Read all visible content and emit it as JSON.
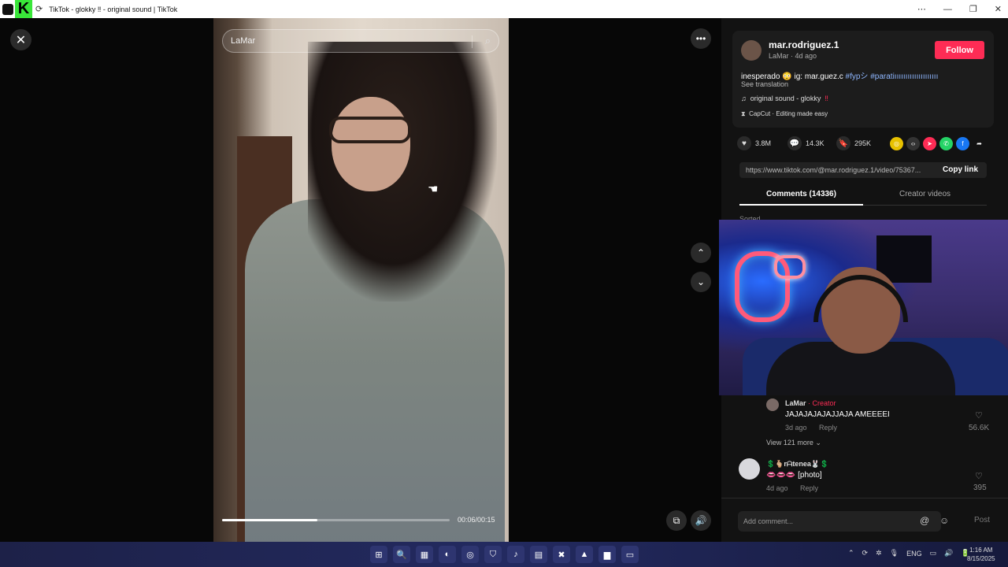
{
  "window": {
    "title": "TikTok - glokky ‼ - original sound | TikTok",
    "controls": [
      "⋯",
      "—",
      "❐",
      "✕"
    ]
  },
  "video": {
    "search_text": "LaMar",
    "time": "00:06/00:15",
    "progress": 0.42
  },
  "author": {
    "username": "mar.rodriguez.1",
    "sub": "LaMar · 4d ago",
    "follow_label": "Follow",
    "desc_text": "inesperado 😳 ig: mar.guez.c ",
    "desc_tags": "#fypシ #paratiıııııııııııııııııııı",
    "see_translation": "See translation",
    "sound": "original sound - glokky",
    "sound_bang": "‼",
    "capcut": "CapCut · Editing made easy"
  },
  "stats": {
    "likes": "3.8M",
    "comments": "14.3K",
    "saves": "295K"
  },
  "share": {
    "link": "https://www.tiktok.com/@mar.rodriguez.1/video/75367...",
    "copy_label": "Copy link"
  },
  "tabs": {
    "comments": "Comments (14336)",
    "creator": "Creator videos"
  },
  "sorted": "Sorted...",
  "comments": [
    {
      "name": "LaMar",
      "badge": " · Creator",
      "text": "JAJAJAJAJAJJAJA AMEEEEI",
      "time": "3d ago",
      "reply": "Reply",
      "likes": "56.6K"
    },
    {
      "name": "💲🫰🏼rᗩtenea🐰💲",
      "badge": "",
      "text": "👄👄👄 [photo]",
      "time": "4d ago",
      "reply": "Reply",
      "likes": "395"
    }
  ],
  "view_more": "View 121 more ⌄",
  "add_comment": {
    "placeholder": "Add comment...",
    "post": "Post"
  },
  "taskbar": {
    "apps": [
      "⊞",
      "🔍",
      "▦",
      "◐",
      "◎",
      "⛉",
      "♪",
      "▤",
      "✖",
      "▲",
      "▆",
      "▭"
    ],
    "tray": [
      "⌃",
      "⟳",
      "✲",
      "🎙",
      "ENG",
      "▭",
      "🔊",
      "🔋"
    ],
    "time": "1:16 AM",
    "date": "8/15/2025"
  }
}
